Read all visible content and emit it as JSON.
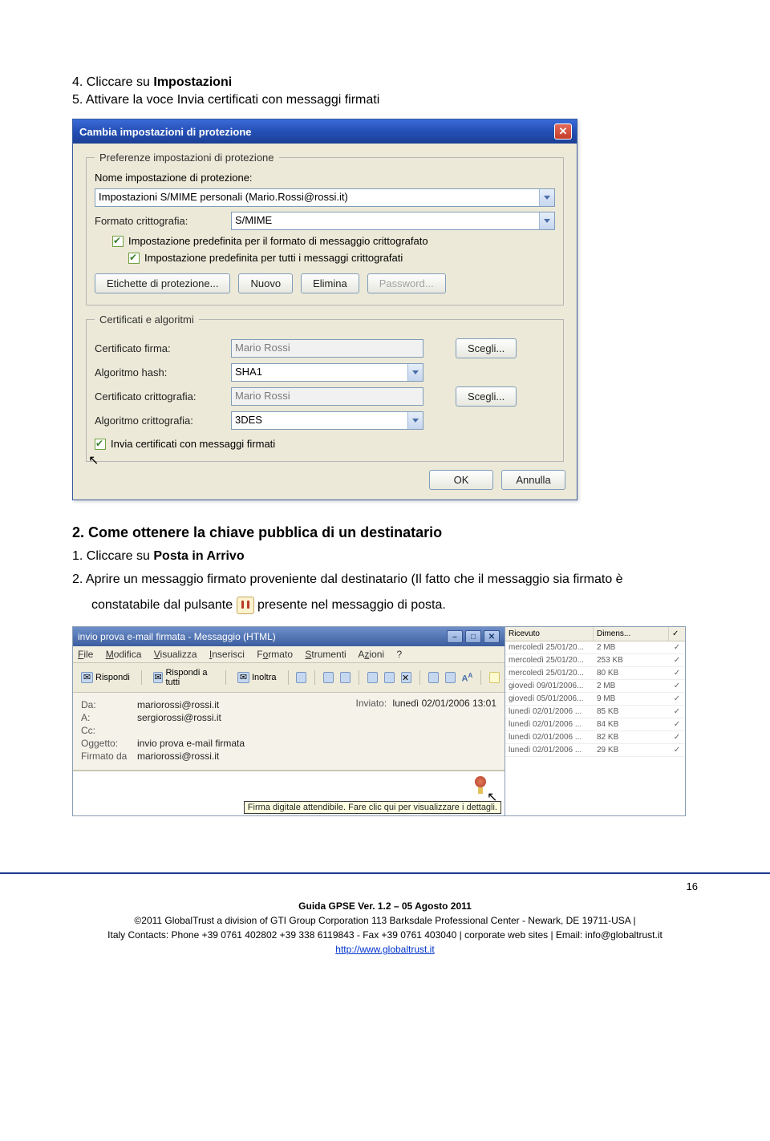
{
  "intro": {
    "step4_num": "4. Cliccare su ",
    "step4_bold": "Impostazioni",
    "step5": "5. Attivare la voce Invia certificati con messaggi firmati"
  },
  "dialog": {
    "title": "Cambia impostazioni di protezione",
    "legend1": "Preferenze impostazioni di protezione",
    "name_label": "Nome impostazione di protezione:",
    "name_value": "Impostazioni S/MIME personali (Mario.Rossi@rossi.it)",
    "format_label": "Formato crittografia:",
    "format_value": "S/MIME",
    "cb1": "Impostazione predefinita per il formato di messaggio crittografato",
    "cb2": "Impostazione predefinita per tutti i messaggi crittografati",
    "btn_labels": "Etichette di protezione...",
    "btn_new": "Nuovo",
    "btn_del": "Elimina",
    "btn_pwd": "Password...",
    "legend2": "Certificati e algoritmi",
    "cert_sign_label": "Certificato firma:",
    "cert_sign_value": "Mario Rossi",
    "btn_choose": "Scegli...",
    "hash_label": "Algoritmo hash:",
    "hash_value": "SHA1",
    "cert_enc_label": "Certificato crittografia:",
    "cert_enc_value": "Mario Rossi",
    "alg_enc_label": "Algoritmo crittografia:",
    "alg_enc_value": "3DES",
    "cb3": "Invia certificati con messaggi firmati",
    "btn_ok": "OK",
    "btn_cancel": "Annulla"
  },
  "section2": {
    "heading_num": "2.  ",
    "heading": "Come ottenere la chiave pubblica di un destinatario",
    "step1_a": "1.  Cliccare su ",
    "step1_b": "Posta in Arrivo",
    "step2_a": "2.  Aprire un messaggio firmato proveniente dal destinatario (Il fatto che il messaggio sia firmato è ",
    "step2_b": "constatabile dal pulsante ",
    "step2_c": " presente  nel messaggio di posta."
  },
  "msg": {
    "title": "invio prova e-mail firmata - Messaggio (HTML)",
    "menu": {
      "file": "File",
      "mod": "Modifica",
      "vis": "Visualizza",
      "ins": "Inserisci",
      "fmt": "Formato",
      "str": "Strumenti",
      "az": "Azioni",
      "help": "?"
    },
    "tb": {
      "reply": "Rispondi",
      "replyall": "Rispondi a tutti",
      "fwd": "Inoltra"
    },
    "hdr": {
      "from_l": "Da:",
      "from_v": "mariorossi@rossi.it",
      "to_l": "A:",
      "to_v": "sergiorossi@rossi.it",
      "cc_l": "Cc:",
      "sub_l": "Oggetto:",
      "sub_v": "invio prova e-mail firmata",
      "sig_l": "Firmato da",
      "sig_v": "mariorossi@rossi.it",
      "sent_l": "Inviato:",
      "sent_v": "lunedì 02/01/2006 13:01"
    },
    "tooltip": "Firma digitale attendibile. Fare clic qui per visualizzare i dettagli."
  },
  "list": {
    "col1": "Ricevuto",
    "col2": "Dimens...",
    "rows": [
      {
        "d": "mercoledì 25/01/20...",
        "s": "2 MB"
      },
      {
        "d": "mercoledì 25/01/20...",
        "s": "253 KB"
      },
      {
        "d": "mercoledì 25/01/20...",
        "s": "80 KB"
      },
      {
        "d": "giovedì 09/01/2006...",
        "s": "2 MB"
      },
      {
        "d": "giovedì 05/01/2006...",
        "s": "9 MB"
      },
      {
        "d": "lunedì 02/01/2006 ...",
        "s": "85 KB"
      },
      {
        "d": "lunedì 02/01/2006 ...",
        "s": "84 KB"
      },
      {
        "d": "lunedì 02/01/2006 ...",
        "s": "82 KB"
      },
      {
        "d": "lunedì 02/01/2006 ...",
        "s": "29 KB"
      }
    ]
  },
  "footer": {
    "pagenum": "16",
    "l1": "Guida GPSE Ver. 1.2 – 05 Agosto 2011",
    "l2": "©2011 GlobalTrust a division of GTI Group Corporation 113 Barksdale Professional Center - Newark, DE 19711-USA |",
    "l3": "Italy Contacts: Phone +39 0761 402802  +39 338 6119843 - Fax +39 0761 403040 | corporate web sites |  Email: info@globaltrust.it",
    "link": "http://www.globaltrust.it"
  }
}
